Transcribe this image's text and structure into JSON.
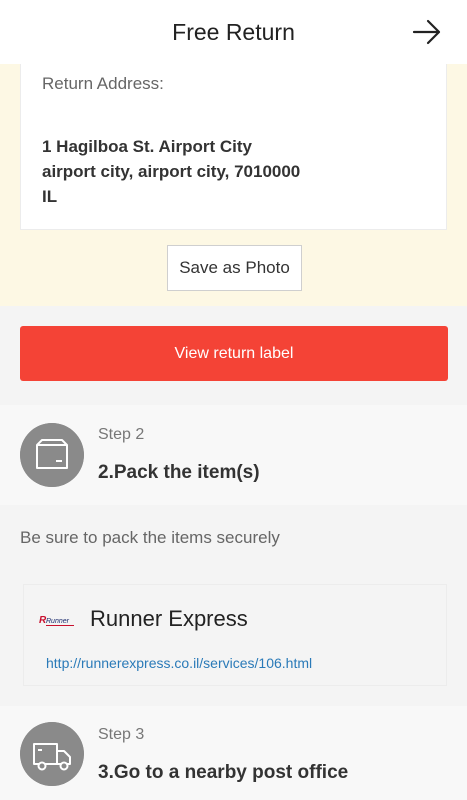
{
  "header": {
    "title": "Free Return"
  },
  "address": {
    "label": "Return Address:",
    "line1": "1 Hagilboa St. Airport City",
    "line2": "airport city, airport city, 7010000",
    "line3": "IL"
  },
  "save_photo_label": "Save as Photo",
  "view_label_button": "View return label",
  "step2": {
    "number": "Step 2",
    "title": "2.Pack the item(s)",
    "note": "Be sure to pack the items securely"
  },
  "courier": {
    "name": "Runner Express",
    "logo_text": "Runner",
    "link": "http://runnerexpress.co.il/services/106.html"
  },
  "step3": {
    "number": "Step 3",
    "title": "3.Go to a nearby post office"
  },
  "colors": {
    "accent": "#f44336",
    "link": "#2a7ab8",
    "highlight_bg": "#fdf8e4",
    "icon_circle": "#8a8a8a"
  },
  "icons": {
    "header": "arrow-right-icon",
    "step2": "package-box-icon",
    "step3": "delivery-truck-icon"
  }
}
